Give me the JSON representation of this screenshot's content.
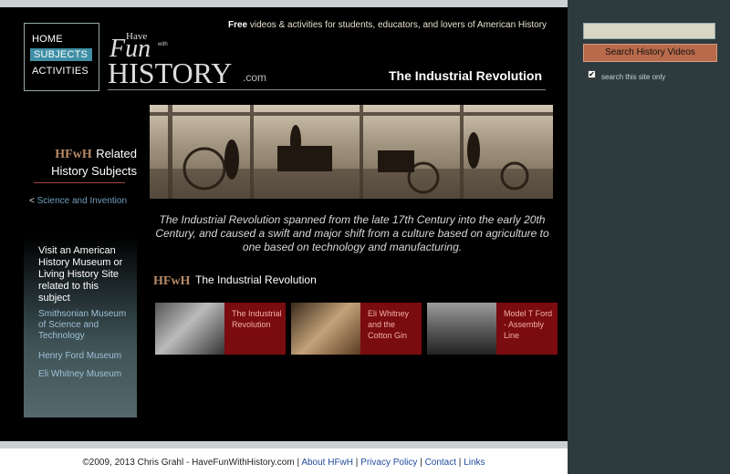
{
  "nav": {
    "home": "HOME",
    "subjects": "SUBJECTS",
    "activities": "ACTIVITIES"
  },
  "logo": {
    "have": "Have",
    "fun": "Fun",
    "with": "with",
    "history": "HISTORY",
    "com": ".com"
  },
  "tagline": {
    "bold": "Free",
    "rest": " videos & activities for students, educators, and lovers of American History"
  },
  "page_title": "The Industrial Revolution",
  "intro": "The Industrial Revolution spanned from the late 17th Century into the early 20th Century, and caused a swift and major shift from a culture based on agriculture to one based on technology and manufacturing.",
  "search": {
    "button_label": "Search History Videos",
    "checkbox_label": "search this site only",
    "checkbox_mark": "✔"
  },
  "related": {
    "monogram": "HFwH",
    "heading_line1": "Related",
    "heading_line2": "History Subjects",
    "link_prefix": "< ",
    "link": "Science and Invention"
  },
  "museums": {
    "heading": "Visit an American History Museum or Living History Site related to this subject",
    "links": [
      "Smithsonian Museum of Science and Technology",
      "Henry Ford Museum",
      "Eli Whitney Museum"
    ]
  },
  "section": {
    "monogram": "HFwH",
    "title": "The Industrial Revolution"
  },
  "cards": [
    {
      "label": "The Industrial Revolution"
    },
    {
      "label": "Eli Whitney and the Cotton Gin"
    },
    {
      "label": "Model T Ford - Assembly Line"
    }
  ],
  "footer": {
    "copyright": "©2009, 2013 Chris Grahl - HaveFunWithHistory.com",
    "sep": " | ",
    "links": [
      "About HFwH",
      "Privacy Policy",
      "Contact",
      "Links"
    ]
  }
}
